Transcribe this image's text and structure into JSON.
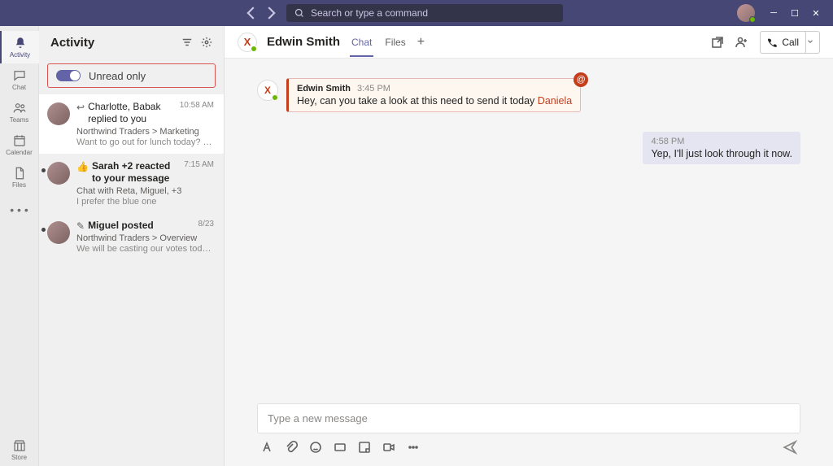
{
  "titlebar": {
    "search_placeholder": "Search or type a command"
  },
  "rail": {
    "activity": "Activity",
    "chat": "Chat",
    "teams": "Teams",
    "calendar": "Calendar",
    "files": "Files",
    "store": "Store"
  },
  "left": {
    "title": "Activity",
    "unread_label": "Unread only",
    "items": [
      {
        "title_pre": "Charlotte, Babak replied to you",
        "time": "10:58 AM",
        "sub": "Northwind Traders > Marketing",
        "preview": "Want to go out for lunch today? It's my..."
      },
      {
        "title_pre": "Sarah +2 reacted to your message",
        "time": "7:15 AM",
        "sub": "Chat with Reta, Miguel, +3",
        "preview": "I prefer the blue one"
      },
      {
        "title_pre": "Miguel posted",
        "time": "8/23",
        "sub": "Northwind Traders > Overview",
        "preview": "We will be casting our votes today, every..."
      }
    ]
  },
  "chat_header": {
    "name": "Edwin Smith",
    "tab_chat": "Chat",
    "tab_files": "Files",
    "call": "Call"
  },
  "messages": {
    "m1": {
      "sender": "Edwin Smith",
      "time": "3:45 PM",
      "text": "Hey, can you take a look at this need to send it today ",
      "mention": "Daniela"
    },
    "m2": {
      "time": "4:58 PM",
      "text": "Yep, I'll just look through it now."
    }
  },
  "composer": {
    "placeholder": "Type a new message"
  }
}
